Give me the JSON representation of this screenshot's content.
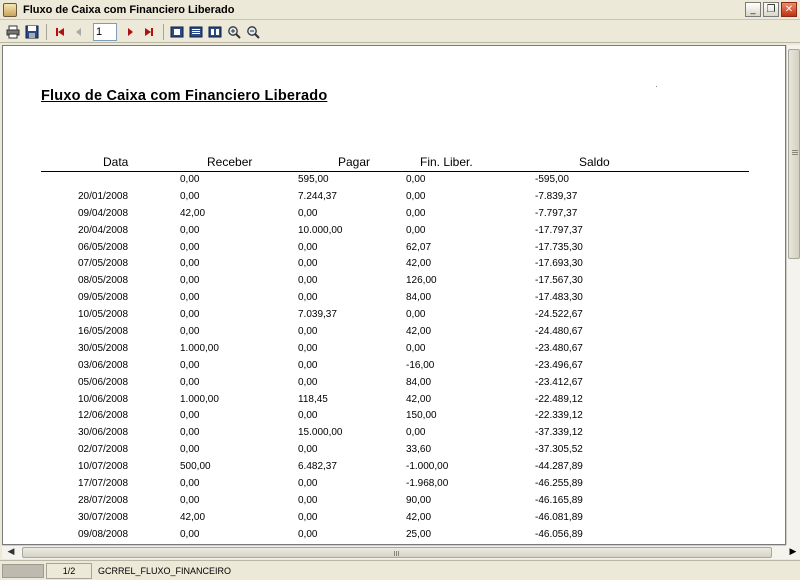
{
  "window": {
    "title": "Fluxo de Caixa com Financiero Liberado"
  },
  "toolbar": {
    "page_value": "1"
  },
  "report": {
    "title": "Fluxo de Caixa com Financiero Liberado",
    "columns": [
      "Data",
      "Receber",
      "Pagar",
      "Fin. Liber.",
      "Saldo"
    ],
    "rows": [
      [
        "",
        "0,00",
        "595,00",
        "0,00",
        "-595,00"
      ],
      [
        "20/01/2008",
        "0,00",
        "7.244,37",
        "0,00",
        "-7.839,37"
      ],
      [
        "09/04/2008",
        "42,00",
        "0,00",
        "0,00",
        "-7.797,37"
      ],
      [
        "20/04/2008",
        "0,00",
        "10.000,00",
        "0,00",
        "-17.797,37"
      ],
      [
        "06/05/2008",
        "0,00",
        "0,00",
        "62,07",
        "-17.735,30"
      ],
      [
        "07/05/2008",
        "0,00",
        "0,00",
        "42,00",
        "-17.693,30"
      ],
      [
        "08/05/2008",
        "0,00",
        "0,00",
        "126,00",
        "-17.567,30"
      ],
      [
        "09/05/2008",
        "0,00",
        "0,00",
        "84,00",
        "-17.483,30"
      ],
      [
        "10/05/2008",
        "0,00",
        "7.039,37",
        "0,00",
        "-24.522,67"
      ],
      [
        "16/05/2008",
        "0,00",
        "0,00",
        "42,00",
        "-24.480,67"
      ],
      [
        "30/05/2008",
        "1.000,00",
        "0,00",
        "0,00",
        "-23.480,67"
      ],
      [
        "03/06/2008",
        "0,00",
        "0,00",
        "-16,00",
        "-23.496,67"
      ],
      [
        "05/06/2008",
        "0,00",
        "0,00",
        "84,00",
        "-23.412,67"
      ],
      [
        "10/06/2008",
        "1.000,00",
        "118,45",
        "42,00",
        "-22.489,12"
      ],
      [
        "12/06/2008",
        "0,00",
        "0,00",
        "150,00",
        "-22.339,12"
      ],
      [
        "30/06/2008",
        "0,00",
        "15.000,00",
        "0,00",
        "-37.339,12"
      ],
      [
        "02/07/2008",
        "0,00",
        "0,00",
        "33,60",
        "-37.305,52"
      ],
      [
        "10/07/2008",
        "500,00",
        "6.482,37",
        "-1.000,00",
        "-44.287,89"
      ],
      [
        "17/07/2008",
        "0,00",
        "0,00",
        "-1.968,00",
        "-46.255,89"
      ],
      [
        "28/07/2008",
        "0,00",
        "0,00",
        "90,00",
        "-46.165,89"
      ],
      [
        "30/07/2008",
        "42,00",
        "0,00",
        "42,00",
        "-46.081,89"
      ],
      [
        "09/08/2008",
        "0,00",
        "0,00",
        "25,00",
        "-46.056,89"
      ]
    ]
  },
  "statusbar": {
    "page": "1/2",
    "report_name": "GCRREL_FLUXO_FINANCEIRO"
  },
  "colors": {
    "nav_arrow": "#b01010",
    "title_close": "#c1330f"
  },
  "icons": [
    "app-icon",
    "print-icon",
    "save-icon",
    "first-page-icon",
    "prev-page-icon",
    "next-page-icon",
    "last-page-icon",
    "single-page-icon",
    "multi-page-icon",
    "page-width-icon",
    "zoom-in-icon",
    "zoom-out-icon",
    "minimize-icon",
    "maximize-icon",
    "close-icon"
  ]
}
